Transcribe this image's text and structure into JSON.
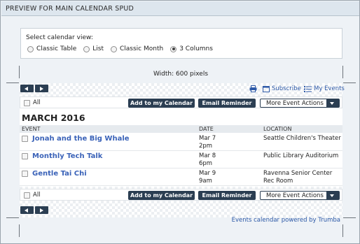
{
  "header": {
    "title": "PREVIEW FOR MAIN CALENDAR SPUD"
  },
  "view_selector": {
    "label": "Select calendar view:",
    "options": [
      {
        "label": "Classic Table",
        "selected": false
      },
      {
        "label": "List",
        "selected": false
      },
      {
        "label": "Classic Month",
        "selected": false
      },
      {
        "label": "3 Columns",
        "selected": true
      }
    ]
  },
  "width_label": "Width: 600 pixels",
  "top_links": {
    "subscribe": "Subscribe",
    "my_events": "My Events"
  },
  "action_bar": {
    "all_label": "All",
    "add_label": "Add to my Calendar",
    "email_label": "Email Reminder",
    "more_label": "More Event Actions"
  },
  "calendar": {
    "month": "MARCH 2016",
    "columns": {
      "event": "EVENT",
      "date": "DATE",
      "location": "LOCATION"
    },
    "events": [
      {
        "title": "Jonah and the Big Whale",
        "date": "Mar 7",
        "time": "2pm",
        "location": "Seattle Children's Theater"
      },
      {
        "title": "Monthly Tech Talk",
        "date": "Mar 8",
        "time": "6pm",
        "location": "Public Library Auditorium"
      },
      {
        "title": "Gentle Tai Chi",
        "date": "Mar 9",
        "time": "9am",
        "location": "Ravenna Senior Center Rec Room"
      }
    ]
  },
  "footer": {
    "powered_by": "Events calendar powered by Trumba"
  },
  "colors": {
    "dark_button": "#2b3e52",
    "link": "#2e5aa8",
    "event_title": "#3a62b8",
    "header_bg": "#dde6ee"
  },
  "icons": [
    "print-icon",
    "calendar-subscribe-icon",
    "list-icon",
    "prev-arrow-icon",
    "next-arrow-icon",
    "dropdown-arrow-icon"
  ]
}
